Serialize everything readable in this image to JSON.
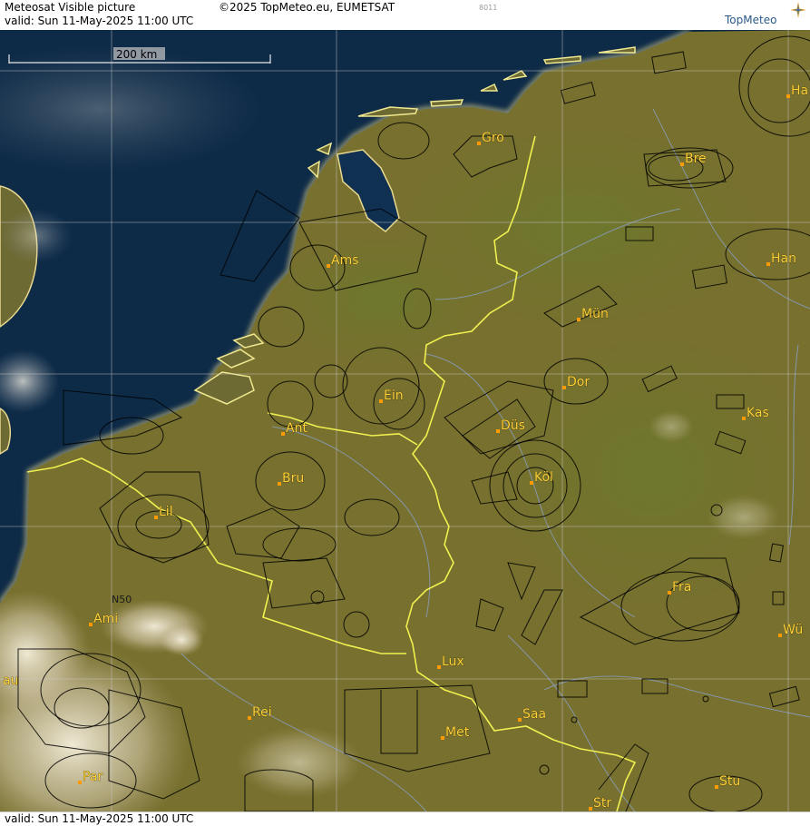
{
  "header": {
    "product_title": "Meteosat Visible picture",
    "copyright": "©2025 TopMeteo.eu, EUMETSAT",
    "valid_text": "valid:  Sun  11-May-2025  11:00 UTC",
    "image_code": "8011",
    "logo_text": "TopMeteo"
  },
  "footer": {
    "valid_text": "valid:  Sun  11-May-2025  11:00 UTC"
  },
  "scale_bar": {
    "label": "200 km"
  },
  "places": [
    {
      "name": "Gro"
    },
    {
      "name": "Ha"
    },
    {
      "name": "Bre"
    },
    {
      "name": "Ams"
    },
    {
      "name": "Han"
    },
    {
      "name": "Mün"
    },
    {
      "name": "Ein"
    },
    {
      "name": "Dor"
    },
    {
      "name": "Kas"
    },
    {
      "name": "Ant"
    },
    {
      "name": "Düs"
    },
    {
      "name": "Bru"
    },
    {
      "name": "Köl"
    },
    {
      "name": "Lil"
    },
    {
      "name": "Fra"
    },
    {
      "name": "N50"
    },
    {
      "name": "Ami"
    },
    {
      "name": "Wü"
    },
    {
      "name": "Lux"
    },
    {
      "name": "Rei"
    },
    {
      "name": "Saa"
    },
    {
      "name": "Met"
    },
    {
      "name": "Par"
    },
    {
      "name": "Stu"
    },
    {
      "name": "Str"
    },
    {
      "name": "au"
    }
  ],
  "colors": {
    "sea": "#0d2a47",
    "land": "#7a7030",
    "coast_glow": "#e8d890",
    "border": "#f0f050",
    "rivers": "#8aa0c8",
    "grid": "#c8c8c8",
    "airspace": "#000000",
    "city_label": "#ffd23c",
    "city_dot": "#ff9a00"
  }
}
